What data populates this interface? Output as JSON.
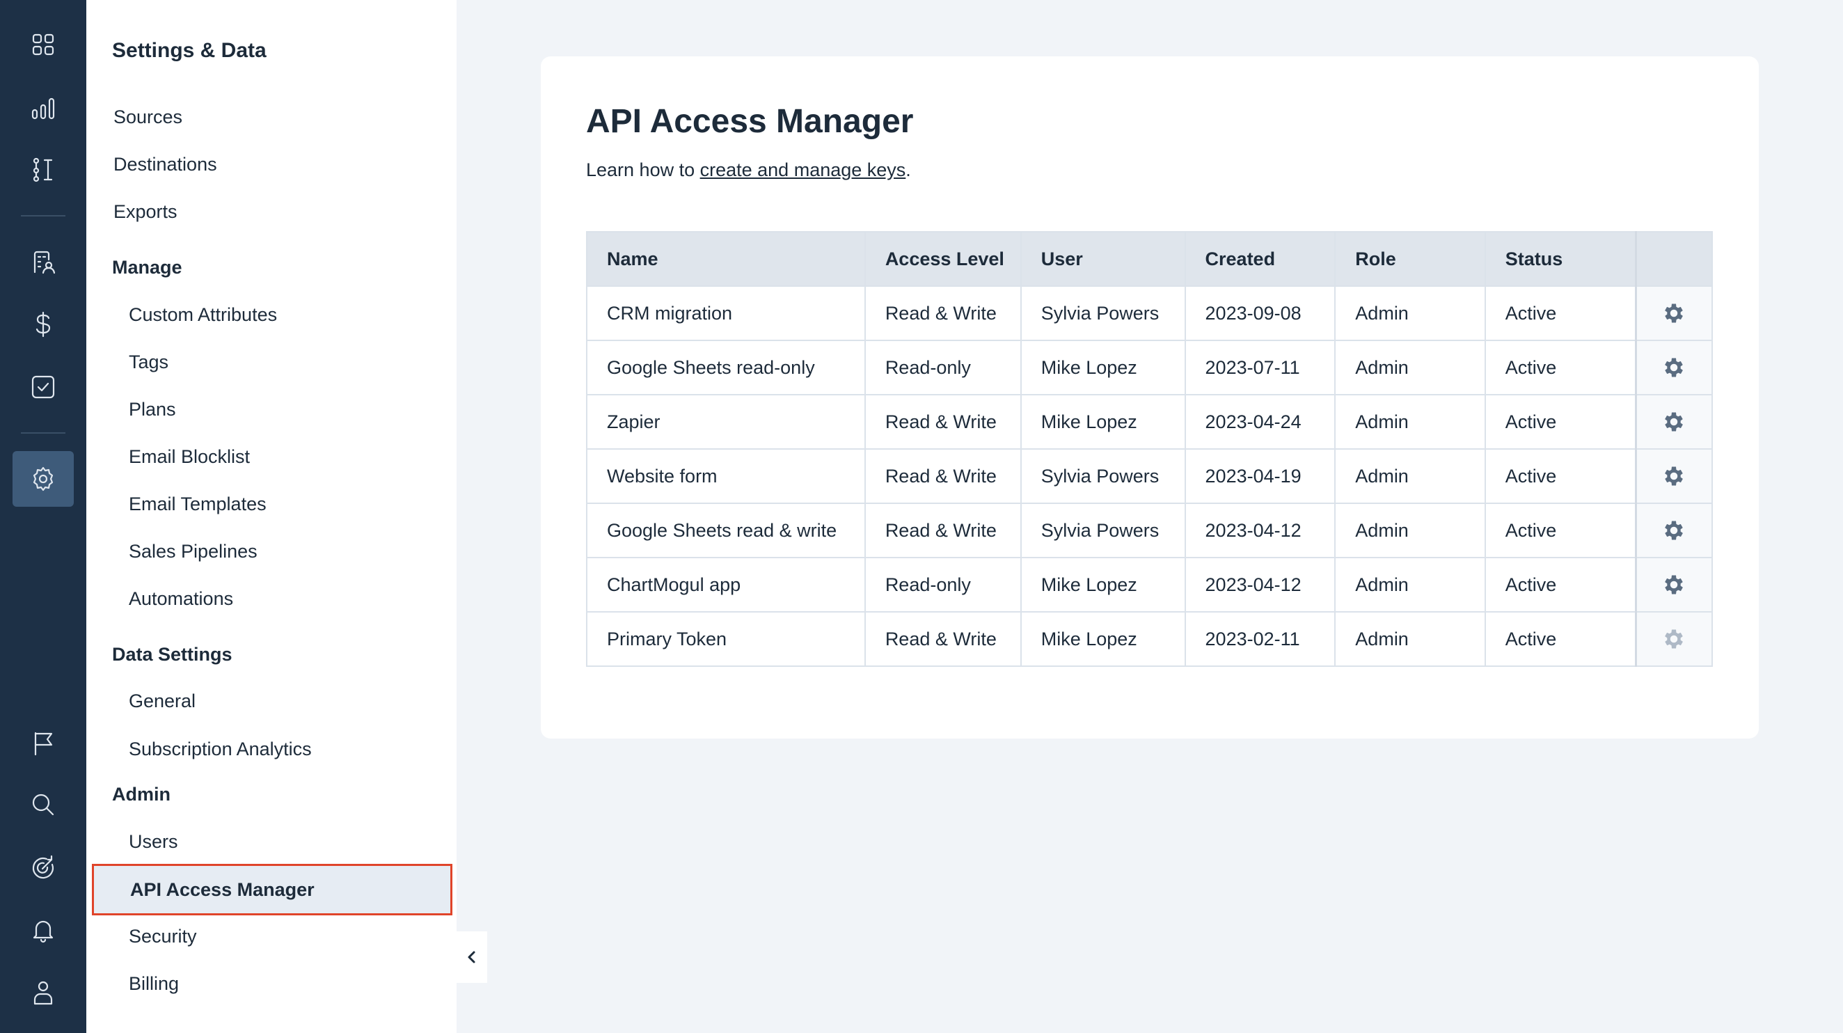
{
  "rail": {
    "icons": [
      "dashboard-icon",
      "bar-chart-icon",
      "pipeline-icon",
      "contacts-icon",
      "dollar-icon",
      "checkbox-icon",
      "settings-icon",
      "flag-icon",
      "search-icon",
      "target-icon",
      "bell-icon",
      "user-icon"
    ],
    "active": "settings-icon"
  },
  "nav": {
    "title": "Settings & Data",
    "items_top": [
      "Sources",
      "Destinations",
      "Exports"
    ],
    "manage": {
      "label": "Manage",
      "items": [
        "Custom Attributes",
        "Tags",
        "Plans",
        "Email Blocklist",
        "Email Templates",
        "Sales Pipelines",
        "Automations"
      ]
    },
    "data_settings": {
      "label": "Data Settings",
      "items": [
        "General",
        "Subscription Analytics"
      ]
    },
    "admin": {
      "label": "Admin",
      "items": [
        "Users",
        "API Access Manager",
        "Security",
        "Billing"
      ],
      "active": "API Access Manager"
    }
  },
  "main": {
    "title": "API Access Manager",
    "subtitle_prefix": "Learn how to ",
    "subtitle_link": "create and manage keys",
    "subtitle_suffix": ".",
    "table": {
      "headers": [
        "Name",
        "Access Level",
        "User",
        "Created",
        "Role",
        "Status",
        ""
      ],
      "rows": [
        {
          "name": "CRM migration",
          "access": "Read & Write",
          "user": "Sylvia Powers",
          "created": "2023-09-08",
          "role": "Admin",
          "status": "Active"
        },
        {
          "name": "Google Sheets read-only",
          "access": "Read-only",
          "user": "Mike Lopez",
          "created": "2023-07-11",
          "role": "Admin",
          "status": "Active"
        },
        {
          "name": "Zapier",
          "access": "Read & Write",
          "user": "Mike Lopez",
          "created": "2023-04-24",
          "role": "Admin",
          "status": "Active"
        },
        {
          "name": "Website form",
          "access": "Read & Write",
          "user": "Sylvia Powers",
          "created": "2023-04-19",
          "role": "Admin",
          "status": "Active"
        },
        {
          "name": "Google Sheets read & write",
          "access": "Read & Write",
          "user": "Sylvia Powers",
          "created": "2023-04-12",
          "role": "Admin",
          "status": "Active"
        },
        {
          "name": "ChartMogul app",
          "access": "Read-only",
          "user": "Mike Lopez",
          "created": "2023-04-12",
          "role": "Admin",
          "status": "Active"
        },
        {
          "name": "Primary Token",
          "access": "Read & Write",
          "user": "Mike Lopez",
          "created": "2023-02-11",
          "role": "Admin",
          "status": "Active"
        }
      ]
    }
  },
  "colors": {
    "rail_bg": "#1d3046",
    "rail_active": "#3e5b7a",
    "highlight_border": "#e0442a",
    "page_bg": "#f1f4f8",
    "table_header_bg": "#dfe5ec"
  }
}
